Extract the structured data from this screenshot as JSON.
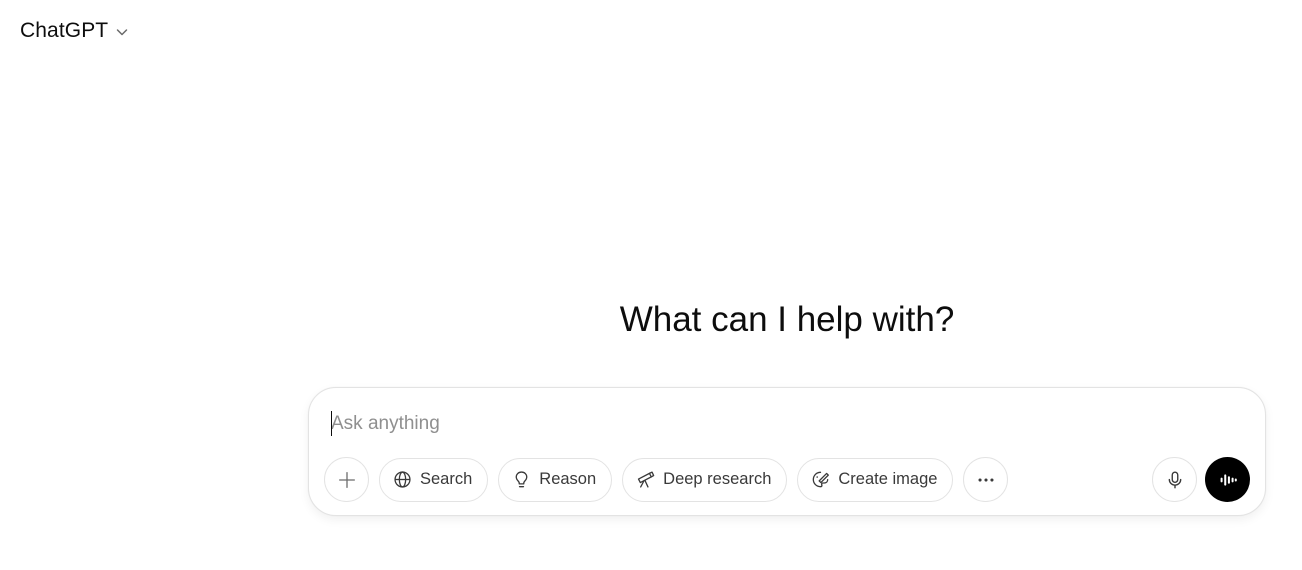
{
  "header": {
    "model_label": "ChatGPT",
    "model_icon": "chevron-down-icon"
  },
  "main": {
    "headline": "What can I help with?"
  },
  "composer": {
    "input_value": "",
    "placeholder": "Ask anything",
    "attach_icon": "plus-icon",
    "tools": [
      {
        "label": "Search",
        "icon": "globe-icon"
      },
      {
        "label": "Reason",
        "icon": "lightbulb-icon"
      },
      {
        "label": "Deep research",
        "icon": "telescope-icon"
      },
      {
        "label": "Create image",
        "icon": "palette-icon"
      }
    ],
    "more_icon": "more-dots-icon",
    "mic_icon": "microphone-icon",
    "voice_icon": "voice-waveform-icon"
  },
  "colors": {
    "background": "#ffffff",
    "text": "#0d0d0d",
    "border": "#e3e3e3",
    "placeholder": "#8f8f8f",
    "voice_button": "#000000"
  }
}
